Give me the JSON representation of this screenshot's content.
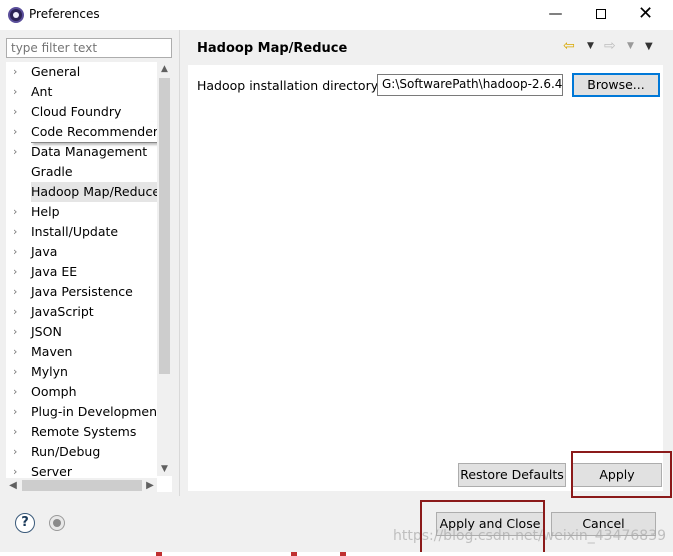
{
  "window": {
    "title": "Preferences",
    "minimize_glyph": "—",
    "close_glyph": "✕"
  },
  "filter": {
    "placeholder": "type filter text"
  },
  "tree": {
    "items": [
      {
        "label": "General",
        "expandable": true
      },
      {
        "label": "Ant",
        "expandable": true
      },
      {
        "label": "Cloud Foundry",
        "expandable": true
      },
      {
        "label": "Code Recommenders",
        "expandable": true
      },
      {
        "label": "Data Management",
        "expandable": true
      },
      {
        "label": "Gradle",
        "expandable": false
      },
      {
        "label": "Hadoop Map/Reduce",
        "expandable": false,
        "selected": true
      },
      {
        "label": "Help",
        "expandable": true
      },
      {
        "label": "Install/Update",
        "expandable": true
      },
      {
        "label": "Java",
        "expandable": true
      },
      {
        "label": "Java EE",
        "expandable": true
      },
      {
        "label": "Java Persistence",
        "expandable": true
      },
      {
        "label": "JavaScript",
        "expandable": true
      },
      {
        "label": "JSON",
        "expandable": true
      },
      {
        "label": "Maven",
        "expandable": true
      },
      {
        "label": "Mylyn",
        "expandable": true
      },
      {
        "label": "Oomph",
        "expandable": true
      },
      {
        "label": "Plug-in Development",
        "expandable": true
      },
      {
        "label": "Remote Systems",
        "expandable": true
      },
      {
        "label": "Run/Debug",
        "expandable": true
      },
      {
        "label": "Server",
        "expandable": true
      }
    ]
  },
  "page": {
    "title": "Hadoop Map/Reduce",
    "install_dir_label": "Hadoop installation directory:",
    "install_dir_value": "G:\\SoftwarePath\\hadoop-2.6.4",
    "browse_label": "Browse..."
  },
  "buttons": {
    "restore_defaults": "Restore Defaults",
    "apply": "Apply",
    "apply_and_close": "Apply and Close",
    "cancel": "Cancel"
  },
  "icons": {
    "help": "?",
    "back_arrow": "⇦",
    "forward_arrow": "⇨",
    "dropdown": "▼",
    "chevron_right": "›"
  },
  "watermark": "https://blog.csdn.net/weixin_43476839",
  "colors": {
    "highlight_box": "#8b1a1a",
    "default_button_border": "#0078d7",
    "back_arrow": "#d8a800"
  }
}
